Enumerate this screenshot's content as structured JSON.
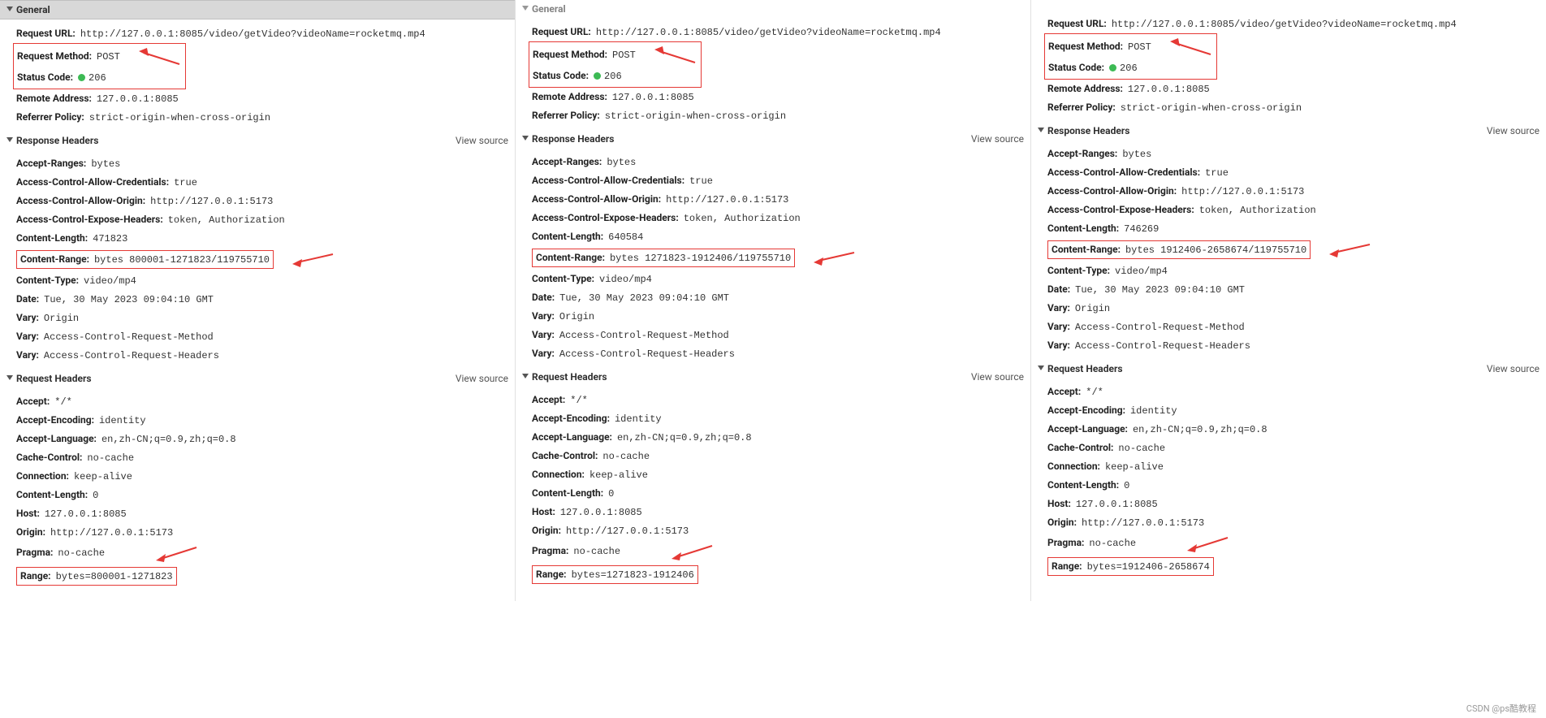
{
  "labels": {
    "general": "General",
    "response_headers": "Response Headers",
    "request_headers": "Request Headers",
    "view_source": "View source"
  },
  "fields": {
    "request_url": "Request URL:",
    "request_method": "Request Method:",
    "status_code": "Status Code:",
    "remote_address": "Remote Address:",
    "referrer_policy": "Referrer Policy:",
    "accept_ranges": "Accept-Ranges:",
    "ac_allow_credentials": "Access-Control-Allow-Credentials:",
    "ac_allow_origin": "Access-Control-Allow-Origin:",
    "ac_expose_headers": "Access-Control-Expose-Headers:",
    "content_length": "Content-Length:",
    "content_range": "Content-Range:",
    "content_type": "Content-Type:",
    "date": "Date:",
    "vary": "Vary:",
    "accept": "Accept:",
    "accept_encoding": "Accept-Encoding:",
    "accept_language": "Accept-Language:",
    "cache_control": "Cache-Control:",
    "connection": "Connection:",
    "host": "Host:",
    "origin": "Origin:",
    "pragma": "Pragma:",
    "range": "Range:"
  },
  "common": {
    "request_url": "http://127.0.0.1:8085/video/getVideo?videoName=rocketmq.mp4",
    "request_method": "POST",
    "status_code": "206",
    "remote_address": "127.0.0.1:8085",
    "referrer_policy": "strict-origin-when-cross-origin",
    "accept_ranges": "bytes",
    "ac_allow_credentials": "true",
    "ac_allow_origin": "http://127.0.0.1:5173",
    "ac_expose_headers": "token, Authorization",
    "content_type": "video/mp4",
    "date": "Tue, 30 May 2023 09:04:10 GMT",
    "vary_origin": "Origin",
    "vary_method": "Access-Control-Request-Method",
    "vary_headers": "Access-Control-Request-Headers",
    "accept": "*/*",
    "accept_encoding": "identity",
    "accept_language": "en,zh-CN;q=0.9,zh;q=0.8",
    "cache_control": "no-cache",
    "connection": "keep-alive",
    "req_content_length": "0",
    "host": "127.0.0.1:8085",
    "origin": "http://127.0.0.1:5173",
    "pragma": "no-cache"
  },
  "p1": {
    "content_length": "471823",
    "content_range": "bytes 800001-1271823/119755710",
    "range": "bytes=800001-1271823"
  },
  "p2": {
    "content_length": "640584",
    "content_range": "bytes 1271823-1912406/119755710",
    "range": "bytes=1271823-1912406"
  },
  "p3": {
    "content_length": "746269",
    "content_range": "bytes 1912406-2658674/119755710",
    "range": "bytes=1912406-2658674"
  },
  "footer": "CSDN @ps酷教程"
}
